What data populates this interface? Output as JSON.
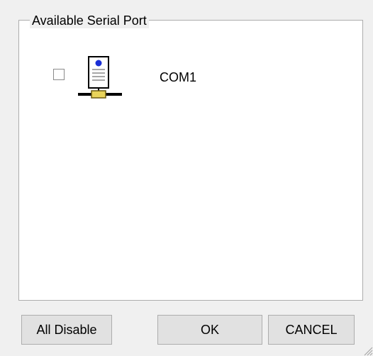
{
  "group": {
    "title": "Available Serial Port"
  },
  "ports": [
    {
      "name": "COM1",
      "checked": false,
      "icon": "serial-port-icon"
    }
  ],
  "buttons": {
    "all_disable": "All Disable",
    "ok": "OK",
    "cancel": "CANCEL"
  }
}
